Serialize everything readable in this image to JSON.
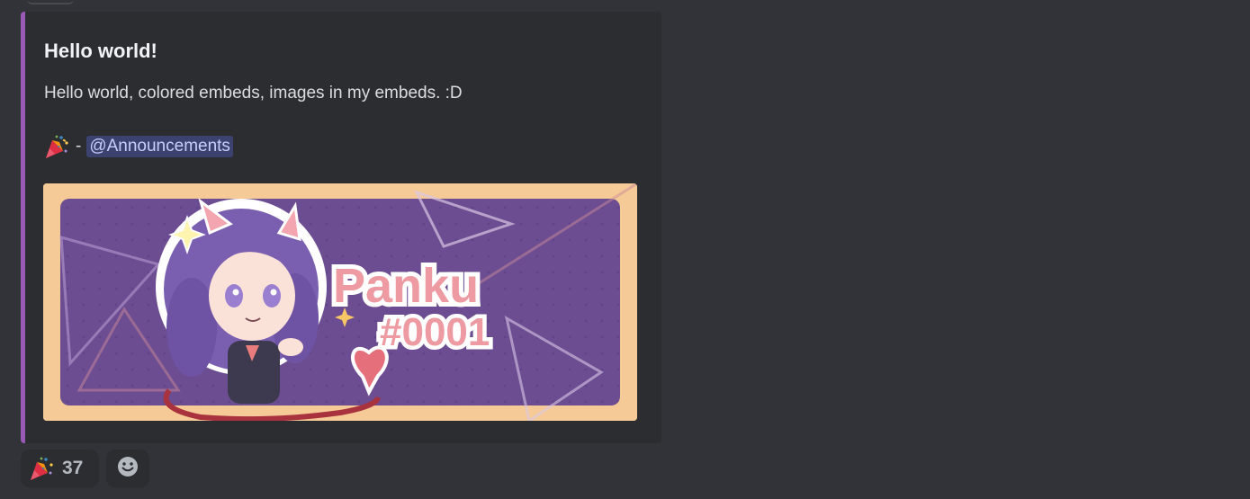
{
  "embed": {
    "accent_color": "#9b59b6",
    "title": "Hello world!",
    "description": "Hello world, colored embeds, images in my embeds. :D",
    "line": {
      "emoji": "party-popper-emoji",
      "separator": "-",
      "mention": "@Announcements"
    },
    "image": {
      "name": "Panku",
      "tag": "#0001"
    }
  },
  "reactions": [
    {
      "emoji": "party-popper-emoji",
      "count": "37"
    },
    {
      "emoji": "add-reaction-smiley-icon"
    }
  ]
}
